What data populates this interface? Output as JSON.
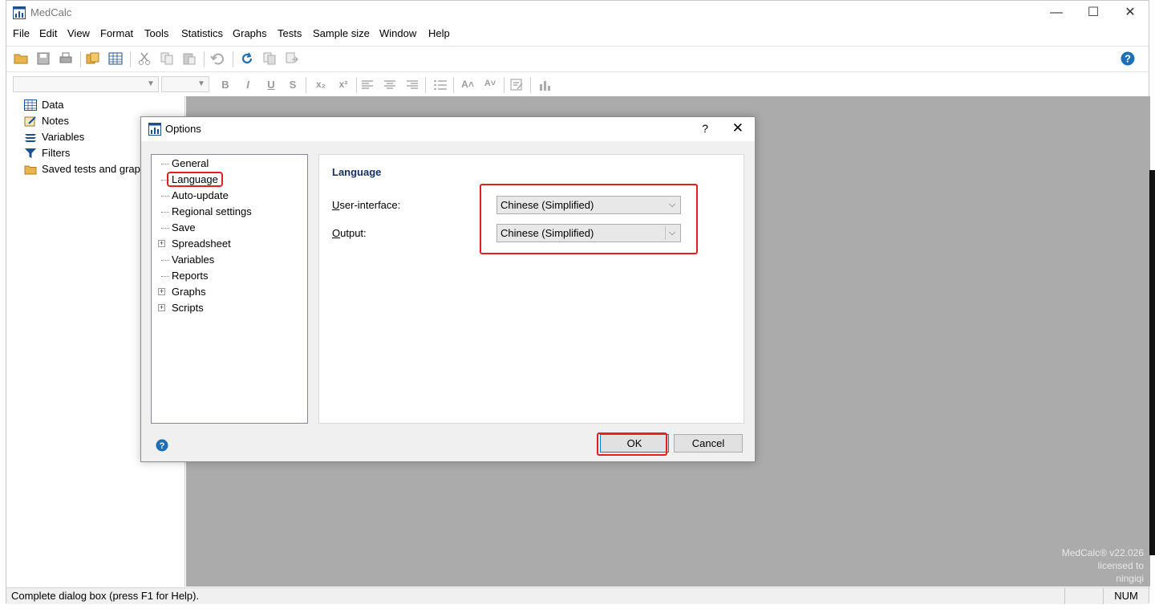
{
  "app": {
    "title": "MedCalc",
    "window_controls": {
      "minimize": "—",
      "maximize": "☐",
      "close": "✕"
    }
  },
  "menu": [
    "File",
    "Edit",
    "View",
    "Format",
    "Tools",
    "Statistics",
    "Graphs",
    "Tests",
    "Sample size",
    "Window",
    "Help"
  ],
  "format_toolbar": {
    "bold": "B",
    "italic": "I",
    "underline": "U",
    "strike": "S",
    "subscript": "x₂",
    "superscript": "x²",
    "grow_font": "A˄",
    "shrink_font": "A˅"
  },
  "left_tree": {
    "items": [
      {
        "label": "Data",
        "icon": "spreadsheet-icon"
      },
      {
        "label": "Notes",
        "icon": "notes-icon"
      },
      {
        "label": "Variables",
        "icon": "variables-icon"
      },
      {
        "label": "Filters",
        "icon": "filter-icon"
      },
      {
        "label": "Saved tests and grap",
        "icon": "folder-icon"
      }
    ]
  },
  "workspace": {
    "version_line1": "MedCalc® v22.026",
    "version_line2": "licensed to",
    "version_line3": "ningiqi"
  },
  "status": {
    "text": "Complete dialog box (press F1 for Help).",
    "num": "NUM"
  },
  "dialog": {
    "title": "Options",
    "help_button": "?",
    "close_button": "✕",
    "tree": [
      {
        "label": "General",
        "expandable": false
      },
      {
        "label": "Language",
        "expandable": false,
        "selected": true
      },
      {
        "label": "Auto-update",
        "expandable": false
      },
      {
        "label": "Regional settings",
        "expandable": false
      },
      {
        "label": "Save",
        "expandable": false
      },
      {
        "label": "Spreadsheet",
        "expandable": true
      },
      {
        "label": "Variables",
        "expandable": false
      },
      {
        "label": "Reports",
        "expandable": false
      },
      {
        "label": "Graphs",
        "expandable": true
      },
      {
        "label": "Scripts",
        "expandable": true
      }
    ],
    "page": {
      "heading": "Language",
      "ui_label_u": "U",
      "ui_label_rest": "ser-interface:",
      "ui_value": "Chinese (Simplified)",
      "output_label_u": "O",
      "output_label_rest": "utput:",
      "output_value": "Chinese (Simplified)"
    },
    "ok": "OK",
    "cancel": "Cancel"
  },
  "colors": {
    "highlight": "#e0201e",
    "heading": "#14305e",
    "workspace": "#ababab",
    "help_blue": "#1f6fb5"
  }
}
